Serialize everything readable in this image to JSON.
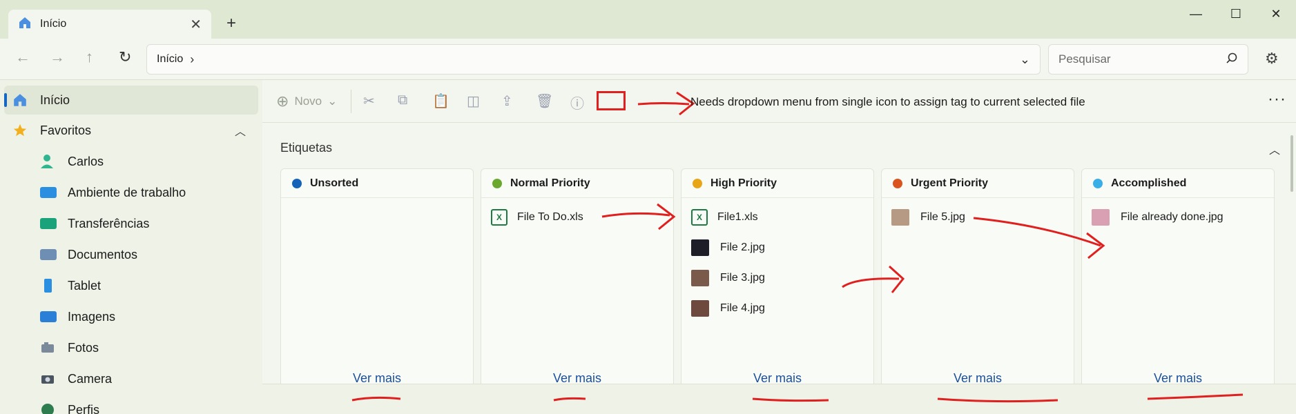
{
  "tab": {
    "title": "Início"
  },
  "address": {
    "crumb": "Início"
  },
  "search": {
    "placeholder": "Pesquisar"
  },
  "sidebar": {
    "items": [
      {
        "label": "Início",
        "active": true,
        "icon": "home-icon"
      },
      {
        "label": "Favoritos",
        "icon": "star-icon"
      },
      {
        "label": "Carlos",
        "icon": "user-icon"
      },
      {
        "label": "Ambiente de trabalho",
        "icon": "desktop-folder-icon"
      },
      {
        "label": "Transferências",
        "icon": "downloads-folder-icon"
      },
      {
        "label": "Documentos",
        "icon": "documents-folder-icon"
      },
      {
        "label": "Tablet",
        "icon": "tablet-icon"
      },
      {
        "label": "Imagens",
        "icon": "pictures-folder-icon"
      },
      {
        "label": "Fotos",
        "icon": "photos-icon"
      },
      {
        "label": "Camera",
        "icon": "camera-icon"
      },
      {
        "label": "Perfis",
        "icon": "profile-icon"
      }
    ]
  },
  "toolbar": {
    "new_label": "Novo",
    "annotation": "Needs dropdown menu from single icon to assign tag to current selected file"
  },
  "section": {
    "title": "Etiquetas"
  },
  "cards": [
    {
      "title": "Unsorted",
      "color": "#1563b8",
      "files": [],
      "more": "Ver mais"
    },
    {
      "title": "Normal Priority",
      "color": "#6aa82d",
      "files": [
        {
          "name": "File To Do.xls",
          "type": "xls"
        }
      ],
      "more": "Ver mais"
    },
    {
      "title": "High Priority",
      "color": "#e8a516",
      "files": [
        {
          "name": "File1.xls",
          "type": "xls"
        },
        {
          "name": "File 2.jpg",
          "type": "jpg"
        },
        {
          "name": "File 3.jpg",
          "type": "jpg"
        },
        {
          "name": "File 4.jpg",
          "type": "jpg"
        }
      ],
      "more": "Ver mais"
    },
    {
      "title": "Urgent Priority",
      "color": "#d9541f",
      "files": [
        {
          "name": "File 5.jpg",
          "type": "jpg"
        }
      ],
      "more": "Ver mais"
    },
    {
      "title": "Accomplished",
      "color": "#3aaee6",
      "files": [
        {
          "name": "File already done.jpg",
          "type": "jpg"
        }
      ],
      "more": "Ver mais"
    }
  ]
}
